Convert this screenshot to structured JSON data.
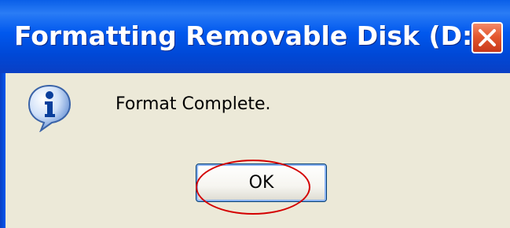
{
  "dialog": {
    "title": "Formatting Removable Disk (D:)",
    "message": "Format Complete.",
    "ok_label": "OK",
    "icon": "info-icon",
    "close_icon": "close-icon"
  },
  "colors": {
    "titlebar": "#0058ee",
    "body": "#ece9d8",
    "close_button": "#e4582f",
    "highlight_ellipse": "#d40000"
  }
}
